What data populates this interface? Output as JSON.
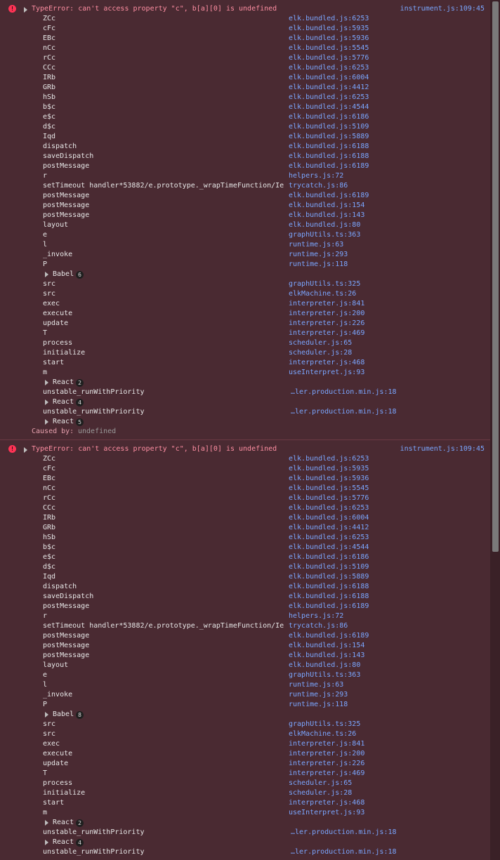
{
  "errors": [
    {
      "message": "TypeError: can't access property \"c\", b[a][0] is undefined",
      "source": "instrument.js:109:45",
      "frames": [
        {
          "fn": "ZCc",
          "src": "elk.bundled.js:6253"
        },
        {
          "fn": "cFc",
          "src": "elk.bundled.js:5935"
        },
        {
          "fn": "EBc",
          "src": "elk.bundled.js:5936"
        },
        {
          "fn": "nCc",
          "src": "elk.bundled.js:5545"
        },
        {
          "fn": "rCc",
          "src": "elk.bundled.js:5776"
        },
        {
          "fn": "CCc",
          "src": "elk.bundled.js:6253"
        },
        {
          "fn": "IRb",
          "src": "elk.bundled.js:6004"
        },
        {
          "fn": "GRb",
          "src": "elk.bundled.js:4412"
        },
        {
          "fn": "hSb",
          "src": "elk.bundled.js:6253"
        },
        {
          "fn": "b$c",
          "src": "elk.bundled.js:4544"
        },
        {
          "fn": "e$c",
          "src": "elk.bundled.js:6186"
        },
        {
          "fn": "d$c",
          "src": "elk.bundled.js:5109"
        },
        {
          "fn": "Iqd",
          "src": "elk.bundled.js:5889"
        },
        {
          "fn": "dispatch",
          "src": "elk.bundled.js:6188"
        },
        {
          "fn": "saveDispatch",
          "src": "elk.bundled.js:6188"
        },
        {
          "fn": "postMessage",
          "src": "elk.bundled.js:6189"
        },
        {
          "fn": "r",
          "src": "helpers.js:72"
        },
        {
          "fn": "setTimeout handler*53882/e.prototype._wrapTimeFunction/Ie",
          "src": "trycatch.js:86"
        },
        {
          "fn": "postMessage",
          "src": "elk.bundled.js:6189"
        },
        {
          "fn": "postMessage",
          "src": "elk.bundled.js:154"
        },
        {
          "fn": "postMessage",
          "src": "elk.bundled.js:143"
        },
        {
          "fn": "layout",
          "src": "elk.bundled.js:80"
        },
        {
          "fn": "e",
          "src": "graphUtils.ts:363"
        },
        {
          "fn": "l",
          "src": "runtime.js:63"
        },
        {
          "fn": "_invoke",
          "src": "runtime.js:293"
        },
        {
          "fn": "P",
          "src": "runtime.js:118"
        },
        {
          "group": "Babel",
          "count": "6"
        },
        {
          "fn": "src",
          "src": "graphUtils.ts:325"
        },
        {
          "fn": "src",
          "src": "elkMachine.ts:26"
        },
        {
          "fn": "exec",
          "src": "interpreter.js:841"
        },
        {
          "fn": "execute",
          "src": "interpreter.js:200"
        },
        {
          "fn": "update",
          "src": "interpreter.js:226"
        },
        {
          "fn": "T",
          "src": "interpreter.js:469"
        },
        {
          "fn": "process",
          "src": "scheduler.js:65"
        },
        {
          "fn": "initialize",
          "src": "scheduler.js:28"
        },
        {
          "fn": "start",
          "src": "interpreter.js:468"
        },
        {
          "fn": "m",
          "src": "useInterpret.js:93"
        },
        {
          "group": "React",
          "count": "2"
        },
        {
          "fn": "unstable_runWithPriority",
          "src": "…ler.production.min.js:18",
          "far": true
        },
        {
          "group": "React",
          "count": "4"
        },
        {
          "fn": "unstable_runWithPriority",
          "src": "…ler.production.min.js:18",
          "far": true
        },
        {
          "group": "React",
          "count": "5"
        }
      ],
      "caused_by": {
        "label": "Caused by:",
        "value": "undefined"
      }
    },
    {
      "message": "TypeError: can't access property \"c\", b[a][0] is undefined",
      "source": "instrument.js:109:45",
      "frames": [
        {
          "fn": "ZCc",
          "src": "elk.bundled.js:6253"
        },
        {
          "fn": "cFc",
          "src": "elk.bundled.js:5935"
        },
        {
          "fn": "EBc",
          "src": "elk.bundled.js:5936"
        },
        {
          "fn": "nCc",
          "src": "elk.bundled.js:5545"
        },
        {
          "fn": "rCc",
          "src": "elk.bundled.js:5776"
        },
        {
          "fn": "CCc",
          "src": "elk.bundled.js:6253"
        },
        {
          "fn": "IRb",
          "src": "elk.bundled.js:6004"
        },
        {
          "fn": "GRb",
          "src": "elk.bundled.js:4412"
        },
        {
          "fn": "hSb",
          "src": "elk.bundled.js:6253"
        },
        {
          "fn": "b$c",
          "src": "elk.bundled.js:4544"
        },
        {
          "fn": "e$c",
          "src": "elk.bundled.js:6186"
        },
        {
          "fn": "d$c",
          "src": "elk.bundled.js:5109"
        },
        {
          "fn": "Iqd",
          "src": "elk.bundled.js:5889"
        },
        {
          "fn": "dispatch",
          "src": "elk.bundled.js:6188"
        },
        {
          "fn": "saveDispatch",
          "src": "elk.bundled.js:6188"
        },
        {
          "fn": "postMessage",
          "src": "elk.bundled.js:6189"
        },
        {
          "fn": "r",
          "src": "helpers.js:72"
        },
        {
          "fn": "setTimeout handler*53882/e.prototype._wrapTimeFunction/Ie",
          "src": "trycatch.js:86"
        },
        {
          "fn": "postMessage",
          "src": "elk.bundled.js:6189"
        },
        {
          "fn": "postMessage",
          "src": "elk.bundled.js:154"
        },
        {
          "fn": "postMessage",
          "src": "elk.bundled.js:143"
        },
        {
          "fn": "layout",
          "src": "elk.bundled.js:80"
        },
        {
          "fn": "e",
          "src": "graphUtils.ts:363"
        },
        {
          "fn": "l",
          "src": "runtime.js:63"
        },
        {
          "fn": "_invoke",
          "src": "runtime.js:293"
        },
        {
          "fn": "P",
          "src": "runtime.js:118"
        },
        {
          "group": "Babel",
          "count": "8"
        },
        {
          "fn": "src",
          "src": "graphUtils.ts:325"
        },
        {
          "fn": "src",
          "src": "elkMachine.ts:26"
        },
        {
          "fn": "exec",
          "src": "interpreter.js:841"
        },
        {
          "fn": "execute",
          "src": "interpreter.js:200"
        },
        {
          "fn": "update",
          "src": "interpreter.js:226"
        },
        {
          "fn": "T",
          "src": "interpreter.js:469"
        },
        {
          "fn": "process",
          "src": "scheduler.js:65"
        },
        {
          "fn": "initialize",
          "src": "scheduler.js:28"
        },
        {
          "fn": "start",
          "src": "interpreter.js:468"
        },
        {
          "fn": "m",
          "src": "useInterpret.js:93"
        },
        {
          "group": "React",
          "count": "2"
        },
        {
          "fn": "unstable_runWithPriority",
          "src": "…ler.production.min.js:18",
          "far": true
        },
        {
          "group": "React",
          "count": "4"
        },
        {
          "fn": "unstable_runWithPriority",
          "src": "…ler.production.min.js:18",
          "far": true
        }
      ]
    }
  ],
  "colors": {
    "background": "#4a2a32",
    "error_text": "#ff8fa3",
    "link": "#7aa6ff",
    "error_icon": "#ff3355"
  }
}
